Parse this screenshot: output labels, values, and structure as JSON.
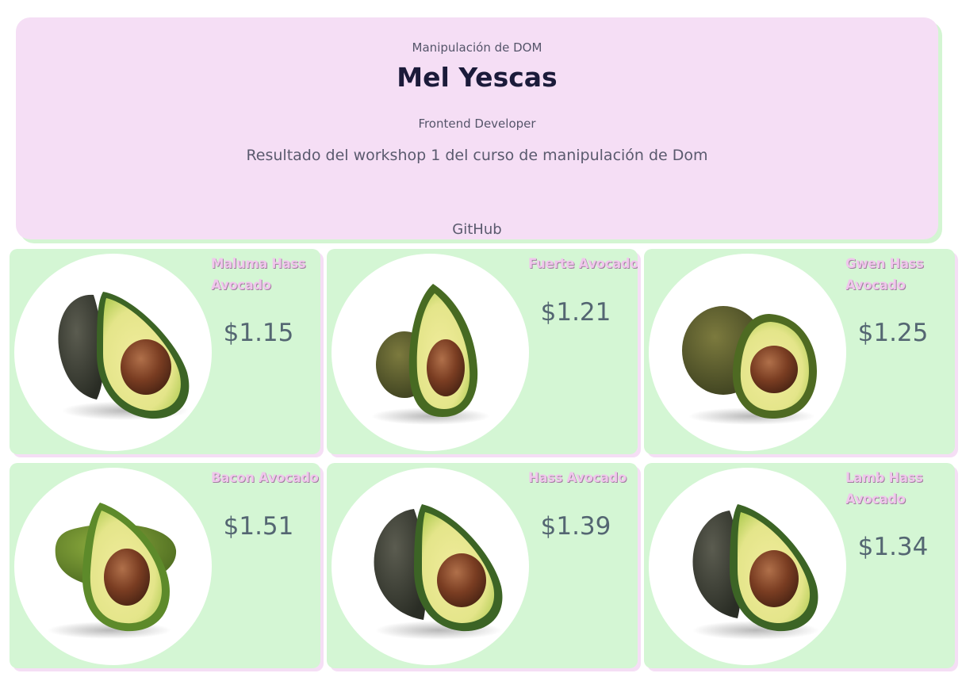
{
  "header": {
    "eyebrow": "Manipulación de DOM",
    "title": "Mel Yescas",
    "role": "Frontend Developer",
    "description": "Resultado del workshop 1 del curso de manipulación de Dom",
    "github_label": "GitHub"
  },
  "colors": {
    "header_bg": "#f5def5",
    "card_bg": "#d4f6d4",
    "title_text": "#1b1b3a",
    "product_name": "#f0c6ec",
    "price_text": "#546672"
  },
  "products": [
    {
      "name": "Maluma Hass Avocado",
      "price": "$1.15",
      "image": "avocado-dark-skin-half-icon"
    },
    {
      "name": "Fuerte Avocado",
      "price": "$1.21",
      "image": "avocado-fuerte-half-icon"
    },
    {
      "name": "Gwen Hass Avocado",
      "price": "$1.25",
      "image": "avocado-gwen-half-icon"
    },
    {
      "name": "Bacon Avocado",
      "price": "$1.51",
      "image": "avocado-bacon-half-icon"
    },
    {
      "name": "Hass Avocado",
      "price": "$1.39",
      "image": "avocado-hass-half-icon"
    },
    {
      "name": "Lamb Hass Avocado",
      "price": "$1.34",
      "image": "avocado-lamb-hass-half-icon"
    }
  ]
}
